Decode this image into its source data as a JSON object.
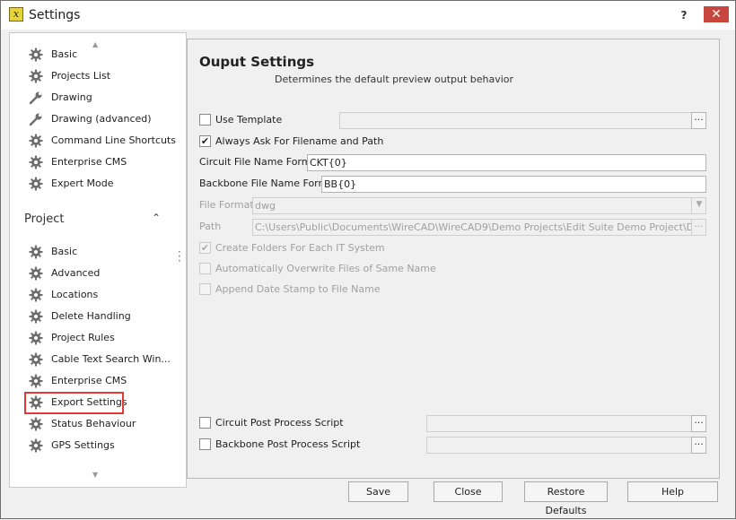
{
  "window": {
    "title": "Settings",
    "app_icon_glyph": "x",
    "help_label": "?",
    "close_label": "✕"
  },
  "sidebar": {
    "up_arrow": "▲",
    "down_arrow": "▼",
    "app_items": [
      {
        "label": "Basic",
        "icon": "gear-icon"
      },
      {
        "label": "Projects List",
        "icon": "gear-icon"
      },
      {
        "label": "Drawing",
        "icon": "wrench-icon"
      },
      {
        "label": "Drawing (advanced)",
        "icon": "wrench-icon"
      },
      {
        "label": "Command Line Shortcuts",
        "icon": "gear-icon"
      },
      {
        "label": "Enterprise CMS",
        "icon": "gear-icon"
      },
      {
        "label": "Expert Mode",
        "icon": "gear-icon"
      }
    ],
    "project_section": {
      "title": "Project",
      "chevron": "⌃"
    },
    "project_items": [
      {
        "label": "Basic",
        "icon": "gear-icon"
      },
      {
        "label": "Advanced",
        "icon": "gear-icon"
      },
      {
        "label": "Locations",
        "icon": "gear-icon"
      },
      {
        "label": "Delete Handling",
        "icon": "gear-icon"
      },
      {
        "label": "Project Rules",
        "icon": "gear-icon"
      },
      {
        "label": "Cable Text Search Win...",
        "icon": "gear-icon"
      },
      {
        "label": "Enterprise CMS",
        "icon": "gear-icon"
      },
      {
        "label": "Export Settings",
        "icon": "gear-icon",
        "selected": true
      },
      {
        "label": "Status Behaviour",
        "icon": "gear-icon"
      },
      {
        "label": "GPS Settings",
        "icon": "gear-icon"
      }
    ]
  },
  "panel": {
    "title": "Ouput Settings",
    "subtitle": "Determines the default preview output behavior",
    "use_template": {
      "label": "Use Template",
      "checked": false,
      "value": "",
      "ellipsis": "···"
    },
    "always_ask": {
      "label": "Always Ask For Filename and Path",
      "checked": true,
      "mark": "✔"
    },
    "circuit_format": {
      "label": "Circuit File Name Format",
      "value": "CKT{0}"
    },
    "backbone_format": {
      "label": "Backbone File Name Format",
      "value": "BB{0}"
    },
    "file_format": {
      "label": "File Format",
      "value": "dwg",
      "arrow": "▼"
    },
    "path": {
      "label": "Path",
      "value": "C:\\Users\\Public\\Documents\\WireCAD\\WireCAD9\\Demo Projects\\Edit Suite Demo Project\\Drawings",
      "ellipsis": "···"
    },
    "create_folders": {
      "label": "Create Folders For Each IT System",
      "checked": true,
      "mark": "✔"
    },
    "auto_overwrite": {
      "label": "Automatically Overwrite Files of Same Name",
      "checked": false
    },
    "append_date": {
      "label": "Append Date Stamp to File Name",
      "checked": false
    },
    "circuit_script": {
      "label": "Circuit Post Process Script",
      "checked": false,
      "value": "",
      "ellipsis": "···"
    },
    "backbone_script": {
      "label": "Backbone Post Process Script",
      "checked": false,
      "value": "",
      "ellipsis": "···"
    }
  },
  "buttons": {
    "save": "Save",
    "close": "Close",
    "restore": "Restore Defaults",
    "help": "Help"
  }
}
